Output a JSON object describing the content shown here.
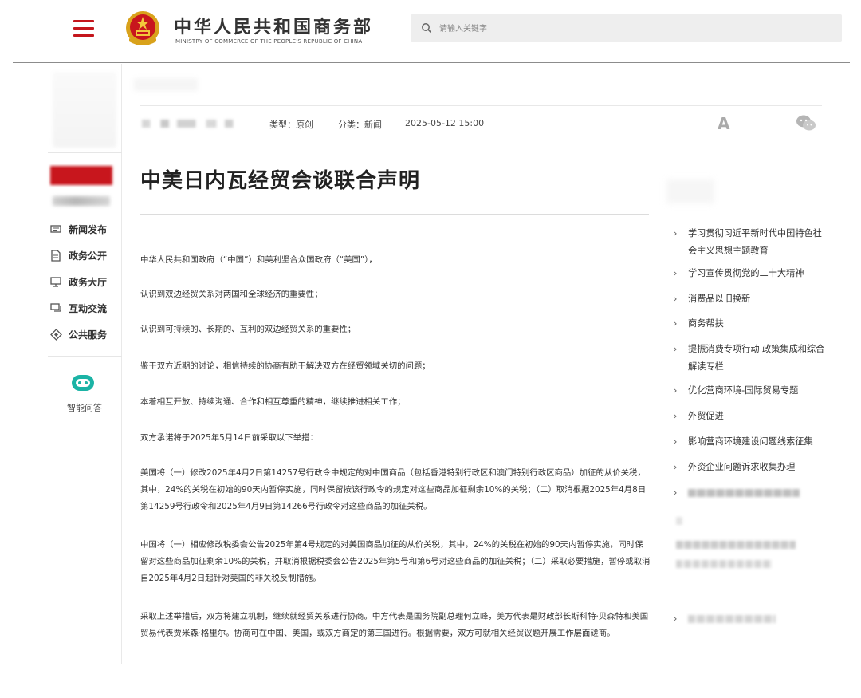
{
  "header": {
    "brand_cn": "中华人民共和国商务部",
    "brand_en": "MINISTRY OF COMMERCE OF THE PEOPLE'S REPUBLIC OF CHINA",
    "search_placeholder": "请输入关键字"
  },
  "leftnav": {
    "items": [
      {
        "label": "新闻发布",
        "icon": "news-icon"
      },
      {
        "label": "政务公开",
        "icon": "document-icon"
      },
      {
        "label": "政务大厅",
        "icon": "monitor-icon"
      },
      {
        "label": "互动交流",
        "icon": "chat-icon"
      },
      {
        "label": "公共服务",
        "icon": "diamond-icon"
      }
    ],
    "assistant_label": "智能问答"
  },
  "article": {
    "meta_type": "类型：原创",
    "meta_category": "分类：新闻",
    "meta_date": "2025-05-12 15:00",
    "font_size_label": "A",
    "title": "中美日内瓦经贸会谈联合声明",
    "paragraphs": [
      "中华人民共和国政府（“中国”）和美利坚合众国政府（“美国”），",
      "认识到双边经贸关系对两国和全球经济的重要性；",
      "认识到可持续的、长期的、互利的双边经贸关系的重要性；",
      "鉴于双方近期的讨论，相信持续的协商有助于解决双方在经贸领域关切的问题；",
      "本着相互开放、持续沟通、合作和相互尊重的精神，继续推进相关工作；",
      "双方承诺将于2025年5月14日前采取以下举措：",
      "美国将（一）修改2025年4月2日第14257号行政令中规定的对中国商品（包括香港特别行政区和澳门特别行政区商品）加征的从价关税，其中，24%的关税在初始的90天内暂停实施，同时保留按该行政令的规定对这些商品加征剩余10%的关税；（二）取消根据2025年4月8日第14259号行政令和2025年4月9日第14266号行政令对这些商品的加征关税。",
      "中国将（一）相应修改税委会公告2025年第4号规定的对美国商品加征的从价关税，其中，24%的关税在初始的90天内暂停实施，同时保留对这些商品加征剩余10%的关税，并取消根据税委会公告2025年第5号和第6号对这些商品的加征关税；（二）采取必要措施，暂停或取消自2025年4月2日起针对美国的非关税反制措施。",
      "采取上述举措后，双方将建立机制，继续就经贸关系进行协商。中方代表是国务院副总理何立峰，美方代表是财政部长斯科特·贝森特和美国贸易代表贾米森·格里尔。协商可在中国、美国，或双方商定的第三国进行。根据需要，双方可就相关经贸议题开展工作层面磋商。"
    ]
  },
  "sidebar": {
    "items": [
      "学习贯彻习近平新时代中国特色社会主义思想主题教育",
      "学习宣传贯彻党的二十大精神",
      "消费品以旧换新",
      "商务帮扶",
      "提振消费专项行动 政策集成和综合解读专栏",
      "优化营商环境-国际贸易专题",
      "外贸促进",
      "影响营商环境建设问题线索征集",
      "外资企业问题诉求收集办理"
    ]
  },
  "colors": {
    "accent": "#c4161c",
    "title": "#222222",
    "body_text": "#333333"
  }
}
